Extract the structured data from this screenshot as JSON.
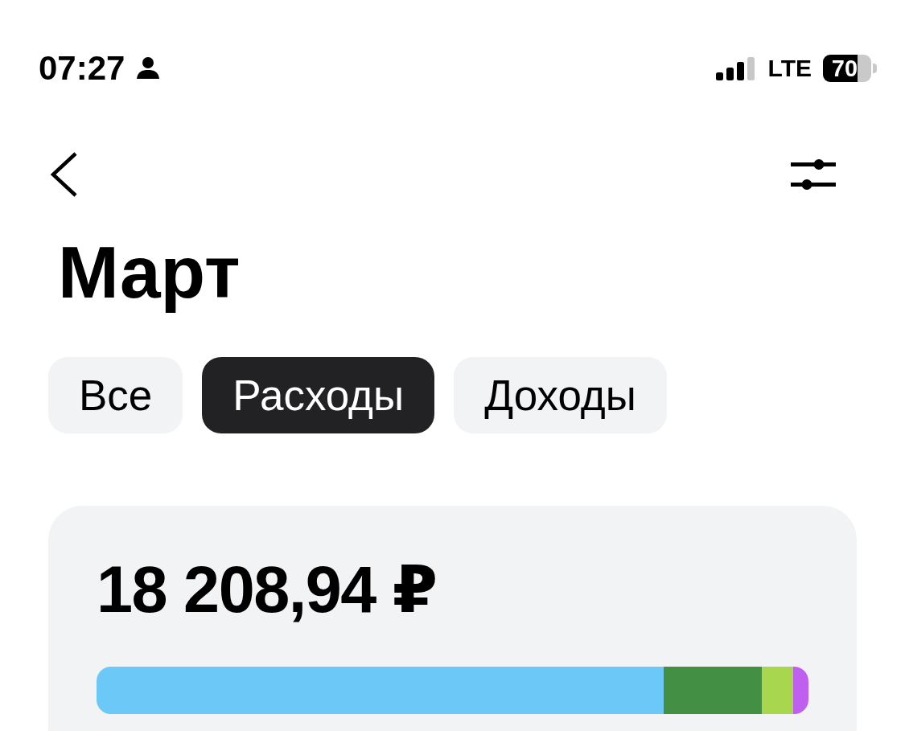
{
  "status_bar": {
    "time": "07:27",
    "network": "LTE",
    "battery": "70"
  },
  "header": {
    "title": "Март"
  },
  "tabs": [
    {
      "label": "Все",
      "selected": false
    },
    {
      "label": "Расходы",
      "selected": true
    },
    {
      "label": "Доходы",
      "selected": false
    }
  ],
  "summary": {
    "total": "18 208,94 ₽"
  }
}
